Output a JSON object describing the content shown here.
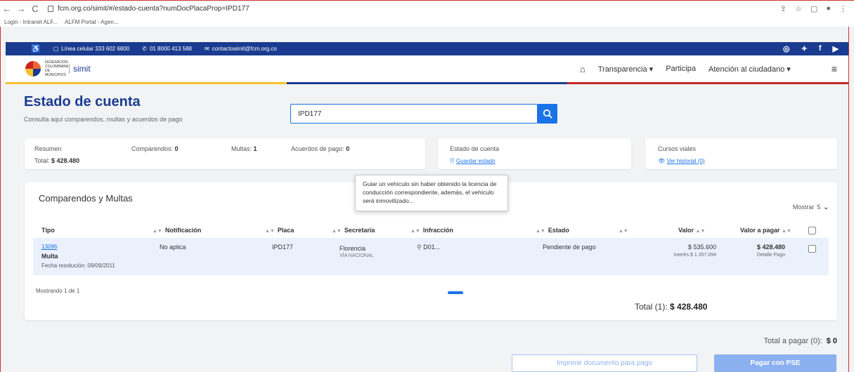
{
  "browser": {
    "url": "fcm.org.co/simit/#/estado-cuenta?numDocPlacaProp=IPD177",
    "bookmarks": [
      "Login - Intranet ALF...",
      "ALFM Portal - Agen..."
    ]
  },
  "info_bar": {
    "phone_cell": "Línea celular 333 602 6800",
    "phone_free": "01 8000 413 588",
    "email": "contactosimit@fcm.org.co"
  },
  "nav": {
    "logo_text": "FEDERACIÓN COLOMBIANA DE MUNICIPIOS",
    "logo_brand": "simit",
    "links": [
      "Transparencia",
      "Participa",
      "Atención al ciudadano"
    ]
  },
  "colors": {
    "blue": "#1a3b8f",
    "yellow": "#fbc02d",
    "red": "#c62828",
    "accent": "#1a73e8"
  },
  "header": {
    "title": "Estado de cuenta",
    "subtitle": "Consulta aquí comparendos, multas y acuerdos de pago",
    "search_value": "IPD177"
  },
  "summary": {
    "resumen_label": "Resumen",
    "total_label": "Total:",
    "total_value": "$ 428.480",
    "comparendos_label": "Comparendos:",
    "comparendos_value": "0",
    "multas_label": "Multas:",
    "multas_value": "1",
    "acuerdos_label": "Acuerdos de pago:",
    "acuerdos_value": "0"
  },
  "estado_card": {
    "title": "Estado de cuenta",
    "link": "Guardar estado"
  },
  "cursos_card": {
    "title": "Cursos viales",
    "link": "Ver historial (0)"
  },
  "table": {
    "title": "Comparendos y Multas",
    "mostrar_label": "Mostrar",
    "mostrar_value": "5",
    "headers": [
      "Tipo",
      "Notificación",
      "Placa",
      "Secretaría",
      "Infracción",
      "Estado",
      "Valor",
      "Valor a pagar"
    ],
    "row": {
      "tipo_link": "13096",
      "tipo_label": "Multa",
      "fecha": "Fecha resolución: 09/09/2011",
      "notificacion": "No aplica",
      "placa": "IPD177",
      "secretaria": "Florencia",
      "secretaria_sub": "VÍA NACIONAL",
      "infraccion": "D01...",
      "estado": "Pendiente de pago",
      "valor": "$ 535.600",
      "interes": "Interés $ 1.357.094",
      "valor_pagar": "$ 428.480",
      "detalle": "Detalle Pago"
    },
    "tooltip": "Guiar un vehículo sin haber obtenido la licencia de conducción correspondiente, además, el vehículo será inmovilizado...",
    "mostrando": "Mostrando 1 de 1",
    "total_label": "Total (1):",
    "total_value": "$ 428.480"
  },
  "footer": {
    "total_pagar_label": "Total a pagar (0):",
    "total_pagar_value": "$ 0",
    "imprimir": "Imprimir documento para pago",
    "pagar": "Pagar con PSE"
  }
}
